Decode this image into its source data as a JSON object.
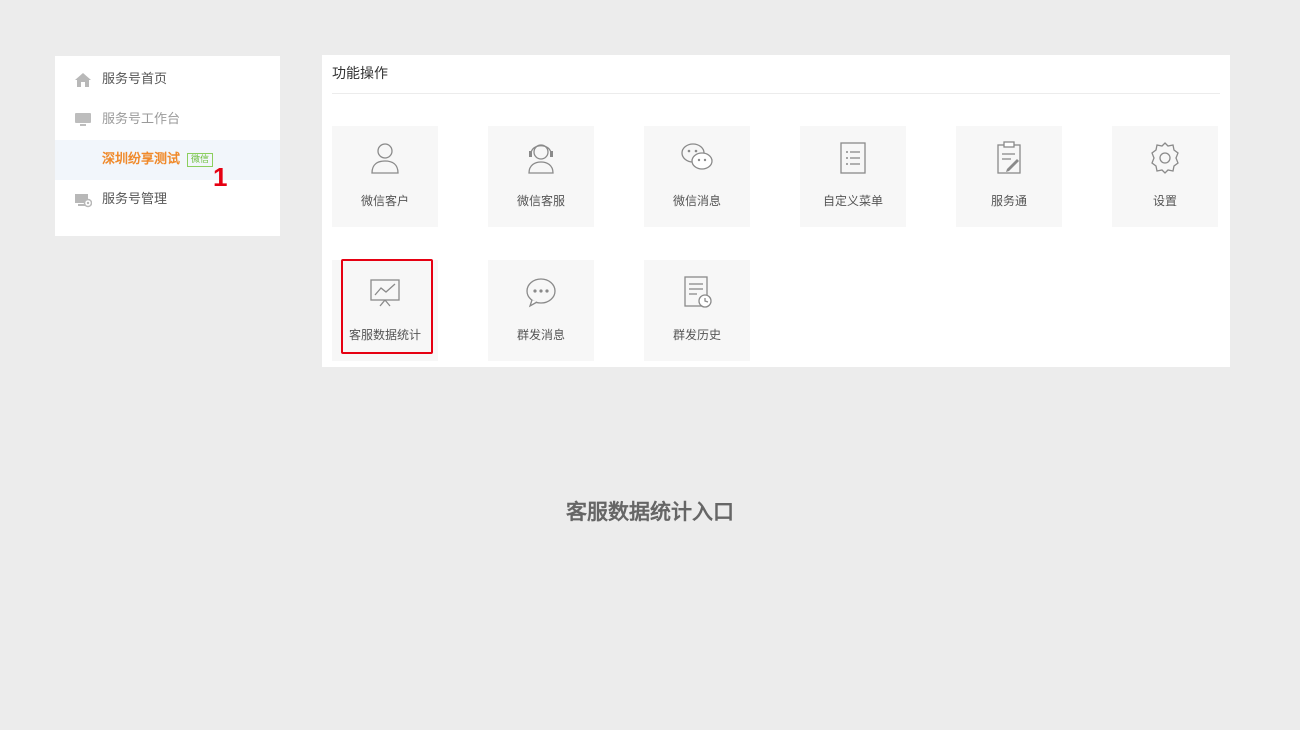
{
  "sidebar": {
    "items": [
      {
        "label": "服务号首页",
        "icon": "home-icon"
      },
      {
        "label": "服务号工作台",
        "icon": "monitor-icon"
      },
      {
        "label": "深圳纷享测试",
        "badge": "微信"
      },
      {
        "label": "服务号管理",
        "icon": "manage-settings-icon"
      }
    ]
  },
  "annotation": {
    "step_number": "1"
  },
  "panel": {
    "title": "功能操作",
    "tiles": [
      {
        "label": "微信客户",
        "icon": "user-icon"
      },
      {
        "label": "微信客服",
        "icon": "headset-agent-icon"
      },
      {
        "label": "微信消息",
        "icon": "wechat-chat-icon"
      },
      {
        "label": "自定义菜单",
        "icon": "menu-list-icon"
      },
      {
        "label": "服务通",
        "icon": "clipboard-edit-icon"
      },
      {
        "label": "设置",
        "icon": "gear-icon"
      },
      {
        "label": "客服数据统计",
        "icon": "chart-board-icon"
      },
      {
        "label": "群发消息",
        "icon": "chat-bubble-icon"
      },
      {
        "label": "群发历史",
        "icon": "history-document-icon"
      }
    ]
  },
  "caption": "客服数据统计入口",
  "colors": {
    "accent_orange": "#f08a2b",
    "annotation_red": "#e60012",
    "badge_green": "#6bbd3a"
  }
}
